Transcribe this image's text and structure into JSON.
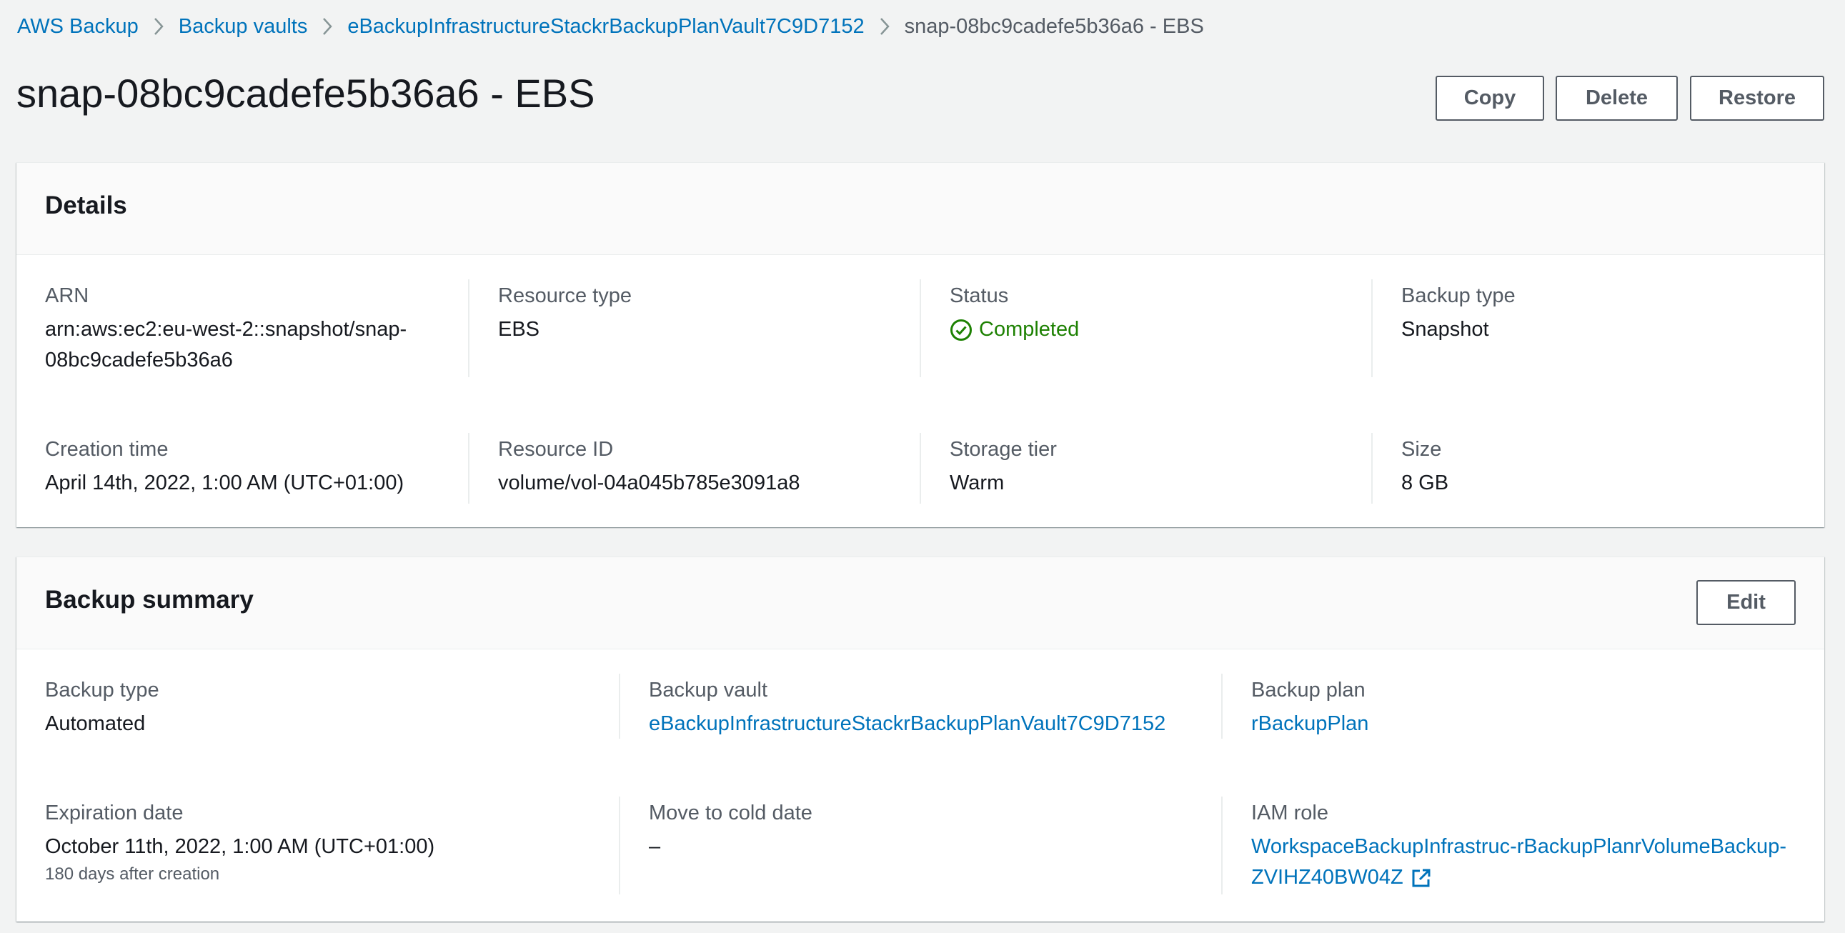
{
  "breadcrumb": {
    "items": [
      "AWS Backup",
      "Backup vaults",
      "eBackupInfrastructureStackrBackupPlanVault7C9D7152"
    ],
    "current": "snap-08bc9cadefe5b36a6 - EBS"
  },
  "header": {
    "title": "snap-08bc9cadefe5b36a6 - EBS",
    "buttons": {
      "copy": "Copy",
      "delete": "Delete",
      "restore": "Restore"
    }
  },
  "details": {
    "title": "Details",
    "arn": {
      "label": "ARN",
      "value_line1": "arn:aws:ec2:eu-west-2::snapshot/snap-",
      "value_line2": "08bc9cadefe5b36a6"
    },
    "resource_type": {
      "label": "Resource type",
      "value": "EBS"
    },
    "status": {
      "label": "Status",
      "value": "Completed",
      "color": "#1d8102"
    },
    "backup_type": {
      "label": "Backup type",
      "value": "Snapshot"
    },
    "creation_time": {
      "label": "Creation time",
      "value": "April 14th, 2022, 1:00 AM (UTC+01:00)"
    },
    "resource_id": {
      "label": "Resource ID",
      "value": "volume/vol-04a045b785e3091a8"
    },
    "storage_tier": {
      "label": "Storage tier",
      "value": "Warm"
    },
    "size": {
      "label": "Size",
      "value": "8 GB"
    }
  },
  "summary": {
    "title": "Backup summary",
    "edit_label": "Edit",
    "backup_type": {
      "label": "Backup type",
      "value": "Automated"
    },
    "backup_vault": {
      "label": "Backup vault",
      "value": "eBackupInfrastructureStackrBackupPlanVault7C9D7152"
    },
    "backup_plan": {
      "label": "Backup plan",
      "value": "rBackupPlan"
    },
    "expiration_date": {
      "label": "Expiration date",
      "value": "October 11th, 2022, 1:00 AM (UTC+01:00)",
      "sub": "180 days after creation"
    },
    "move_to_cold": {
      "label": "Move to cold date",
      "value": "–"
    },
    "iam_role": {
      "label": "IAM role",
      "value_line1": "WorkspaceBackupInfrastruc-rBackupPlanrVolumeBackup-",
      "value_line2": "ZVIHZ40BW04Z"
    }
  },
  "colors": {
    "link": "#0073bb",
    "success": "#1d8102",
    "background": "#f2f3f3"
  },
  "icons": [
    "chevron-right-icon",
    "check-circle-icon",
    "external-link-icon"
  ]
}
